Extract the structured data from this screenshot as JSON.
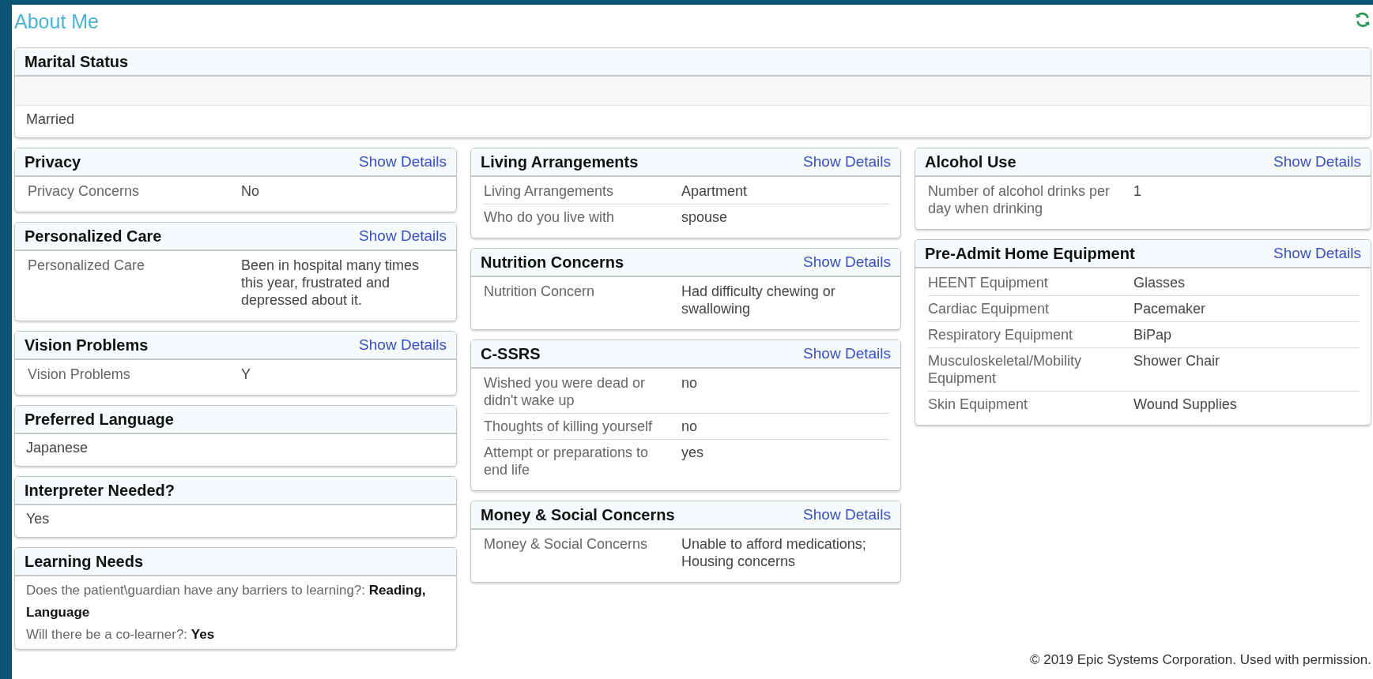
{
  "title": "About Me",
  "marital_status": {
    "heading": "Marital Status",
    "value": "Married"
  },
  "columns": [
    {
      "cards": [
        {
          "kind": "details",
          "heading": "Privacy",
          "link": "Show Details",
          "rows": [
            {
              "label": "Privacy Concerns",
              "value": "No"
            }
          ]
        },
        {
          "kind": "details",
          "heading": "Personalized Care",
          "link": "Show Details",
          "rows": [
            {
              "label": "Personalized Care",
              "value": "Been in hospital many times this year, frustrated and depressed about it."
            }
          ]
        },
        {
          "kind": "details",
          "heading": "Vision Problems",
          "link": "Show Details",
          "rows": [
            {
              "label": "Vision Problems",
              "value": "Y"
            }
          ]
        },
        {
          "kind": "single",
          "heading": "Preferred Language",
          "value": "Japanese"
        },
        {
          "kind": "single",
          "heading": "Interpreter Needed?",
          "value": "Yes"
        },
        {
          "kind": "lines",
          "heading": "Learning Needs",
          "lines": [
            "Does the patient\\guardian have any barriers to learning?: **Reading, Language**",
            "Will there be a co-learner?: **Yes**"
          ]
        }
      ]
    },
    {
      "cards": [
        {
          "kind": "details",
          "heading": "Living Arrangements",
          "link": "Show Details",
          "rows": [
            {
              "label": "Living Arrangements",
              "value": "Apartment"
            },
            {
              "label": "Who do you live with",
              "value": "spouse"
            }
          ]
        },
        {
          "kind": "details",
          "heading": "Nutrition Concerns",
          "link": "Show Details",
          "rows": [
            {
              "label": "Nutrition Concern",
              "value": "Had difficulty chewing or swallowing"
            }
          ]
        },
        {
          "kind": "details",
          "heading": "C-SSRS",
          "link": "Show Details",
          "rows": [
            {
              "label": "Wished you were dead or didn't wake up",
              "value": "no"
            },
            {
              "label": "Thoughts of killing yourself",
              "value": "no"
            },
            {
              "label": "Attempt or preparations to end life",
              "value": "yes"
            }
          ]
        },
        {
          "kind": "details",
          "heading": "Money & Social Concerns",
          "link": "Show Details",
          "rows": [
            {
              "label": "Money & Social Concerns",
              "value": "Unable to afford medications; Housing concerns"
            }
          ]
        }
      ]
    },
    {
      "cards": [
        {
          "kind": "details",
          "heading": "Alcohol Use",
          "link": "Show Details",
          "rows": [
            {
              "label": "Number of alcohol drinks per day when drinking",
              "value": "1"
            }
          ]
        },
        {
          "kind": "details",
          "heading": "Pre-Admit Home Equipment",
          "link": "Show Details",
          "rows": [
            {
              "label": "HEENT Equipment",
              "value": "Glasses"
            },
            {
              "label": "Cardiac Equipment",
              "value": "Pacemaker"
            },
            {
              "label": "Respiratory Equipment",
              "value": "BiPap"
            },
            {
              "label": "Musculoskeletal/Mobility Equipment",
              "value": "Shower Chair"
            },
            {
              "label": "Skin Equipment",
              "value": "Wound Supplies"
            }
          ]
        }
      ]
    }
  ],
  "credit": "© 2019 Epic Systems Corporation. Used with permission."
}
